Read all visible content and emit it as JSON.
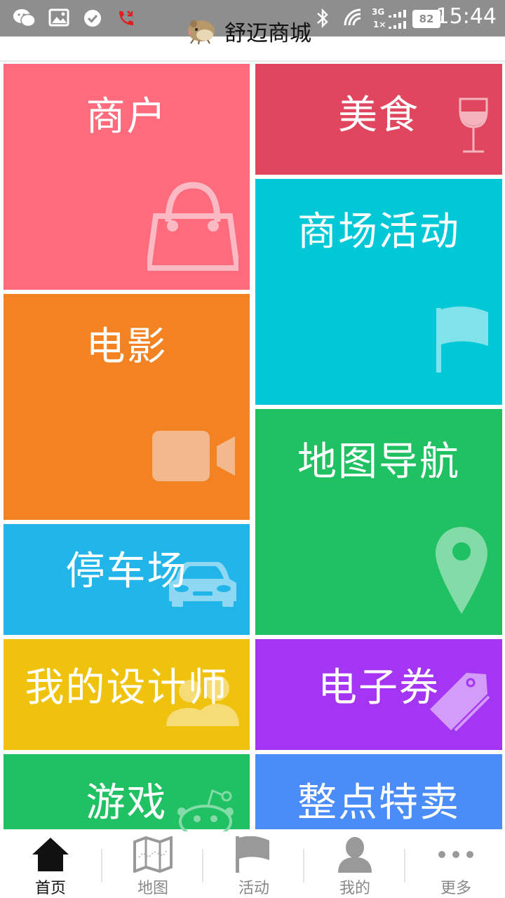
{
  "status_bar": {
    "time": "15:44",
    "battery": "82",
    "network_label": "3G",
    "speed_label": "1×",
    "icons": [
      "wechat-icon",
      "gallery-icon",
      "check-icon",
      "missed-call-icon",
      "bluetooth-icon",
      "wifi-icon",
      "signal-icon",
      "battery-icon"
    ]
  },
  "header": {
    "title": "舒迈商城",
    "logo_icon": "hamster-logo-icon"
  },
  "tiles": [
    {
      "id": "shops",
      "label": "商户",
      "color": "#fd6b7d",
      "icon": "shopping-bag-icon"
    },
    {
      "id": "food",
      "label": "美食",
      "color": "#e0475e",
      "icon": "wine-glass-icon"
    },
    {
      "id": "mall_events",
      "label": "商场活动",
      "color": "#00c8d6",
      "icon": "flag-icon"
    },
    {
      "id": "movies",
      "label": "电影",
      "color": "#f28222",
      "icon": "video-camera-icon"
    },
    {
      "id": "map_nav",
      "label": "地图导航",
      "color": "#20c163",
      "icon": "map-pin-icon"
    },
    {
      "id": "parking",
      "label": "停车场",
      "color": "#21b5ea",
      "icon": "car-icon"
    },
    {
      "id": "designer",
      "label": "我的设计师",
      "color": "#efc20d",
      "icon": "people-icon"
    },
    {
      "id": "coupons",
      "label": "电子券",
      "color": "#a435f2",
      "icon": "tag-icon"
    },
    {
      "id": "games",
      "label": "游戏",
      "color": "#20c163",
      "icon": "reddit-robot-icon"
    },
    {
      "id": "flash_sale",
      "label": "整点特卖",
      "color": "#4b8df8",
      "icon": "none"
    }
  ],
  "bottom_nav": {
    "items": [
      {
        "label": "首页",
        "icon": "home-icon",
        "active": true
      },
      {
        "label": "地图",
        "icon": "map-icon",
        "active": false
      },
      {
        "label": "活动",
        "icon": "flag-icon",
        "active": false
      },
      {
        "label": "我的",
        "icon": "user-icon",
        "active": false
      },
      {
        "label": "更多",
        "icon": "more-dots-icon",
        "active": false
      }
    ]
  },
  "colors": {
    "status_bar_bg": "#8e8e8e",
    "nav_active": "#111111",
    "nav_inactive": "#888888"
  }
}
